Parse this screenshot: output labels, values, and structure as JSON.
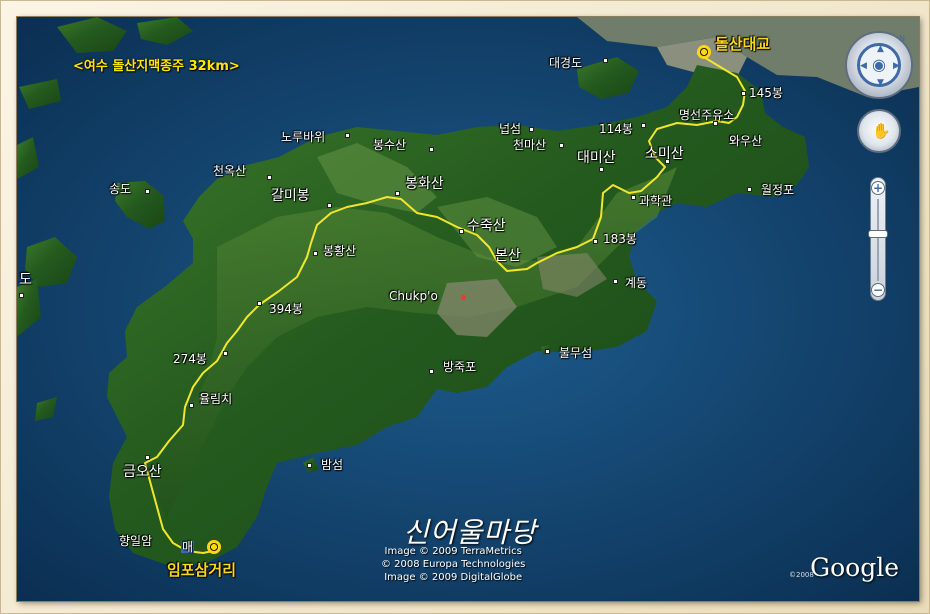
{
  "title": "<여수 돌산지맥종주 32km>",
  "watermark": "신어울마당",
  "credits": [
    "Image © 2009 TerraMetrics",
    "© 2008 Europa Technologies",
    "Image © 2009 DigitalGlobe"
  ],
  "google_logo": "Google",
  "google_year": "©2008",
  "start_label": "돌산대교",
  "end_label": "임포삼거리",
  "mark_label": "매",
  "places": [
    {
      "id": "daegyeongdo",
      "text": "대경도"
    },
    {
      "id": "145bong",
      "text": "145봉"
    },
    {
      "id": "myeongseon",
      "text": "명선주유소"
    },
    {
      "id": "114bong",
      "text": "114봉"
    },
    {
      "id": "wauisan",
      "text": "와우산"
    },
    {
      "id": "neopseom",
      "text": "넙섬"
    },
    {
      "id": "cheonmasan",
      "text": "천마산"
    },
    {
      "id": "daemisan",
      "text": "대미산"
    },
    {
      "id": "somisan",
      "text": "소미산"
    },
    {
      "id": "gwahakgwan",
      "text": "과학관"
    },
    {
      "id": "woljeongpo",
      "text": "월정포"
    },
    {
      "id": "noturbawi",
      "text": "노루바위"
    },
    {
      "id": "bongsusan",
      "text": "봉수산"
    },
    {
      "id": "cheonoksan",
      "text": "천옥산"
    },
    {
      "id": "songdo",
      "text": "송도"
    },
    {
      "id": "galmibong",
      "text": "갈미봉"
    },
    {
      "id": "bonghwasan",
      "text": "봉화산"
    },
    {
      "id": "sujuksan",
      "text": "수죽산"
    },
    {
      "id": "183bong",
      "text": "183봉"
    },
    {
      "id": "bongsan",
      "text": "본산"
    },
    {
      "id": "bonghwangsan",
      "text": "봉황산"
    },
    {
      "id": "gyedong",
      "text": "계동"
    },
    {
      "id": "chukpo",
      "text": "Chukp'o"
    },
    {
      "id": "394bong",
      "text": "394봉"
    },
    {
      "id": "274bong",
      "text": "274봉"
    },
    {
      "id": "bangjukpo",
      "text": "방죽포"
    },
    {
      "id": "bulmuseom",
      "text": "불무섬"
    },
    {
      "id": "yullimchi",
      "text": "율림치"
    },
    {
      "id": "geumosan",
      "text": "금오산"
    },
    {
      "id": "bamseom",
      "text": "밤섬"
    },
    {
      "id": "hyangiram",
      "text": "향일암"
    },
    {
      "id": "do",
      "text": "도"
    }
  ],
  "controls": {
    "compass_icon": "eye-icon",
    "look_icon": "hand-icon",
    "zoom_in": "+",
    "zoom_out": "−"
  }
}
